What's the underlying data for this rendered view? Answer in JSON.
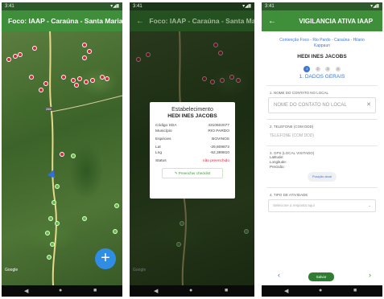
{
  "status": {
    "time": "3:41",
    "icons": "▾◢▮"
  },
  "map_screen": {
    "title": "Foco: IAAP - Caraúna - Santa Maria",
    "fab_label": "+",
    "google_label": "Google",
    "road_label": "285"
  },
  "dialog_screen": {
    "title": "Foco: IAAP - Caraúna - Santa Maria",
    "back": "←",
    "dialog": {
      "title": "Estabelecimento",
      "name": "HEDI INES JACOBS",
      "rows": [
        {
          "label": "Código SDA",
          "value": "4310502077"
        },
        {
          "label": "Município",
          "value": "RIO PARDO"
        },
        {
          "label": "Espécies",
          "value": "BOVINOS"
        },
        {
          "label": "Lat",
          "value": "-29,809872"
        },
        {
          "label": "Lng",
          "value": "-52,389810"
        },
        {
          "label": "Status",
          "value": "não preenchido"
        }
      ],
      "button": "Preencher checklist"
    }
  },
  "form_screen": {
    "title": "VIGILANCIA ATIVA IAAP",
    "back": "←",
    "context": "Contenção Foco - Rio Pardo - Caraúna - Hilario Kappaun",
    "owner": "HEDI INES JACOBS",
    "steps": [
      "1",
      "2",
      "3",
      "4"
    ],
    "section": "1. DADOS GERAIS",
    "q1_label": "1. NOME DO CONTATO NO LOCAL",
    "q1_placeholder": "NOME DO CONTATO NO LOCAL",
    "q1_clear": "✕",
    "q2_label": "2. TELEFONE (COM DDD)",
    "q2_placeholder": "TELEFONE (COM DDD)",
    "q3_label": "3. GPS (LOCAL VISITADO)",
    "gps_lines": [
      "Latitude:",
      "Longitude:",
      "Precisão:"
    ],
    "gps_button": "Posição atual",
    "q4_label": "4. TIPO DE ATIVIDADE",
    "q4_placeholder": "Selecione a resposta aqui",
    "prev": "‹",
    "save": "Salvar",
    "next": "›"
  },
  "nav": {
    "back": "◀",
    "home": "●",
    "recent": "■"
  }
}
